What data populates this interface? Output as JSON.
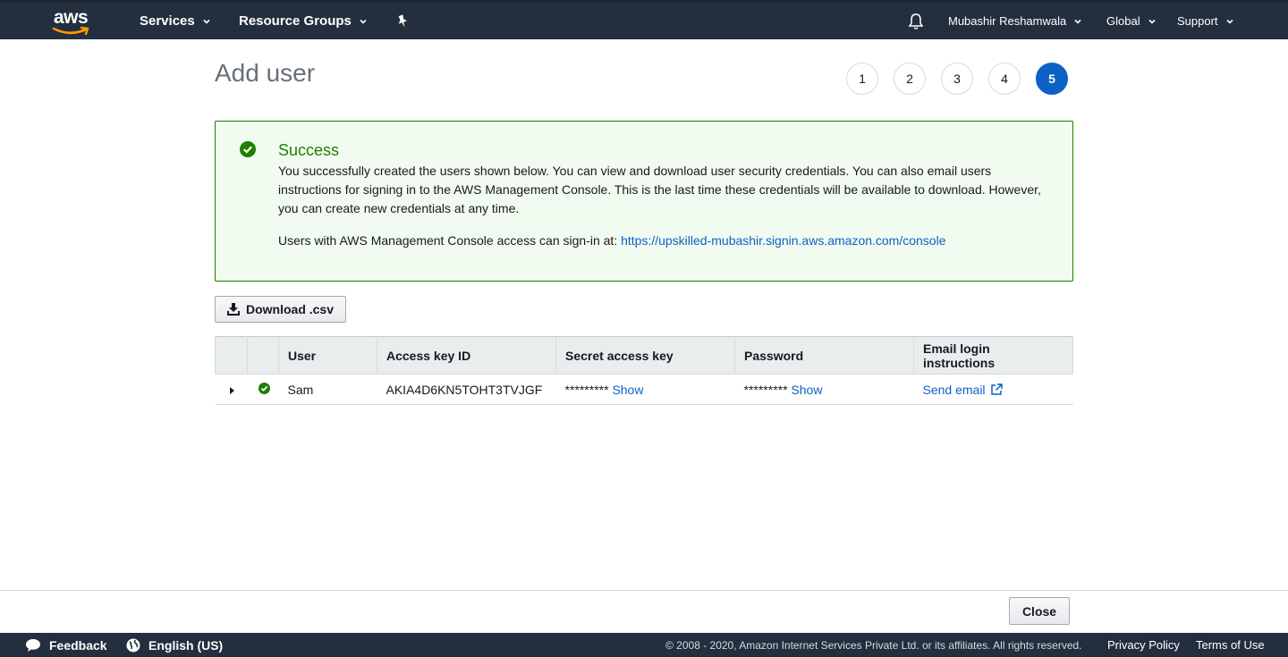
{
  "nav": {
    "logo": "aws",
    "services": "Services",
    "resource_groups": "Resource Groups",
    "user": "Mubashir Reshamwala",
    "region": "Global",
    "support": "Support"
  },
  "page": {
    "title": "Add user",
    "steps": [
      "1",
      "2",
      "3",
      "4",
      "5"
    ],
    "active_step": "5"
  },
  "alert": {
    "title": "Success",
    "body": "You successfully created the users shown below. You can view and download user security credentials. You can also email users instructions for signing in to the AWS Management Console. This is the last time these credentials will be available to download. However, you can create new credentials at any time.",
    "signin_text": "Users with AWS Management Console access can sign-in at:",
    "signin_url": "https://upskilled-mubashir.signin.aws.amazon.com/console"
  },
  "download_label": "Download .csv",
  "table": {
    "headers": [
      "User",
      "Access key ID",
      "Secret access key",
      "Password",
      "Email login instructions"
    ],
    "row": {
      "user": "Sam",
      "access_key_id": "AKIA4D6KN5TOHT3TVJGF",
      "secret_mask": "*********",
      "secret_show": "Show",
      "password_mask": "*********",
      "password_show": "Show",
      "email": "Send email"
    }
  },
  "close_label": "Close",
  "footer": {
    "feedback": "Feedback",
    "language": "English (US)",
    "copyright": "© 2008 - 2020, Amazon Internet Services Private Ltd. or its affiliates. All rights reserved.",
    "privacy": "Privacy Policy",
    "terms": "Terms of Use"
  },
  "colors": {
    "nav_bg": "#232f3e",
    "success": "#1d8102",
    "link": "#0b61c4",
    "logo_smile": "#ff9900"
  }
}
